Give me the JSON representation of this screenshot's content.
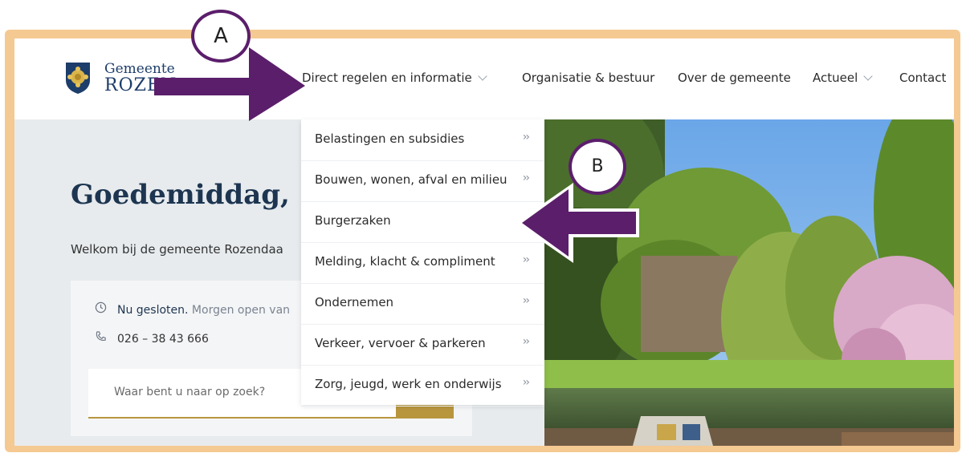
{
  "site": {
    "logo": {
      "line1": "Gemeente",
      "line2": "ROZEN"
    },
    "nav": [
      {
        "label": "Direct regelen en informatie",
        "has_dropdown": true
      },
      {
        "label": "Organisatie & bestuur",
        "has_dropdown": false
      },
      {
        "label": "Over de gemeente",
        "has_dropdown": false
      },
      {
        "label": "Actueel",
        "has_dropdown": true
      },
      {
        "label": "Contact",
        "has_dropdown": false
      }
    ],
    "hero": {
      "greeting": "Goedemiddag,",
      "welcome": "Welkom bij de gemeente Rozendaa"
    },
    "info": {
      "status_strong": "Nu gesloten.",
      "status_rest": " Morgen open van",
      "phone": "026 – 38 43 666"
    },
    "search": {
      "placeholder": "Waar bent u naar op zoek?"
    },
    "dropdown": {
      "arrow": "››",
      "items": [
        {
          "label": "Belastingen en subsidies",
          "has_arrow": true
        },
        {
          "label": "Bouwen, wonen, afval en milieu",
          "has_arrow": true
        },
        {
          "label": "Burgerzaken",
          "has_arrow": false
        },
        {
          "label": "Melding, klacht & compliment",
          "has_arrow": true
        },
        {
          "label": "Ondernemen",
          "has_arrow": true
        },
        {
          "label": "Verkeer, vervoer & parkeren",
          "has_arrow": true
        },
        {
          "label": "Zorg, jeugd, werk en onderwijs",
          "has_arrow": true
        }
      ]
    }
  },
  "annotations": {
    "a": "A",
    "b": "B"
  },
  "colors": {
    "frame": "#f5c992",
    "annotation_purple": "#5b1e6b",
    "heading_navy": "#1d3550",
    "search_gold": "#b8963e"
  }
}
